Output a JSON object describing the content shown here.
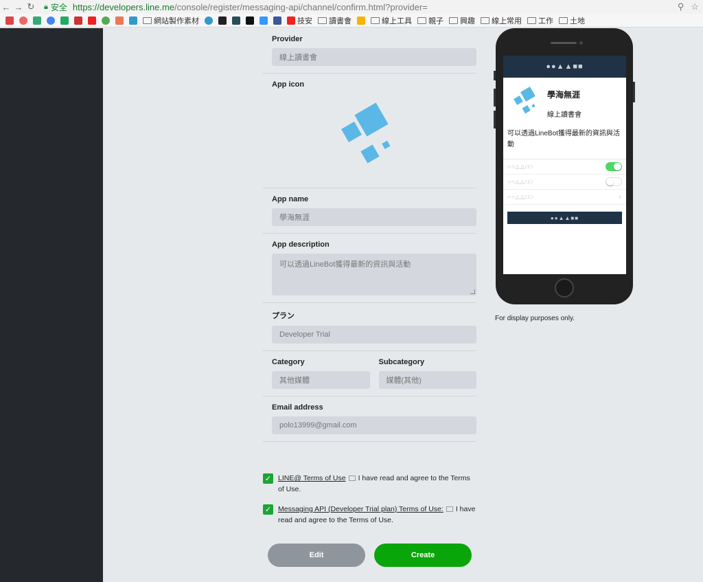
{
  "browser": {
    "secure_label": "安全",
    "url_host": "https://developers.line.me",
    "url_path": "/console/register/messaging-api/channel/confirm.html?provider="
  },
  "bookmarks": [
    "網站製作素材",
    "技安",
    "讀書會",
    "線上工具",
    "親子",
    "興趣",
    "線上常用",
    "工作",
    "土地"
  ],
  "form": {
    "provider_label": "Provider",
    "provider_value": "線上讀書會",
    "app_icon_label": "App icon",
    "app_name_label": "App name",
    "app_name_value": "學海無涯",
    "app_desc_label": "App description",
    "app_desc_value": "可以透過LineBot獲得最新的資訊與活動",
    "plan_label": "プラン",
    "plan_value": "Developer Trial",
    "category_label": "Category",
    "category_value": "其他媒體",
    "subcategory_label": "Subcategory",
    "subcategory_value": "媒體(其他)",
    "email_label": "Email address",
    "email_value": "polo13999@gmail.com"
  },
  "terms": {
    "line_terms_link": "LINE@ Terms of Use",
    "line_terms_text": "I have read and agree to the Terms of Use.",
    "api_terms_link": "Messaging API (Developer Trial plan) Terms of Use:",
    "api_terms_text": "I have read and agree to the Terms of Use."
  },
  "buttons": {
    "edit": "Edit",
    "create": "Create"
  },
  "preview": {
    "header_glyphs": "●●▲▲■■",
    "app_name": "學海無涯",
    "provider": "線上讀書會",
    "description": "可以透過LineBot獲得最新的資訊與活動",
    "row_placeholder": "○○△△□□",
    "button_glyphs": "●●▲▲■■",
    "note": "For display purposes only."
  },
  "colors": {
    "accent_green": "#0aa50a",
    "icon_blue": "#5bb8e6",
    "preview_header": "#1f3246"
  }
}
